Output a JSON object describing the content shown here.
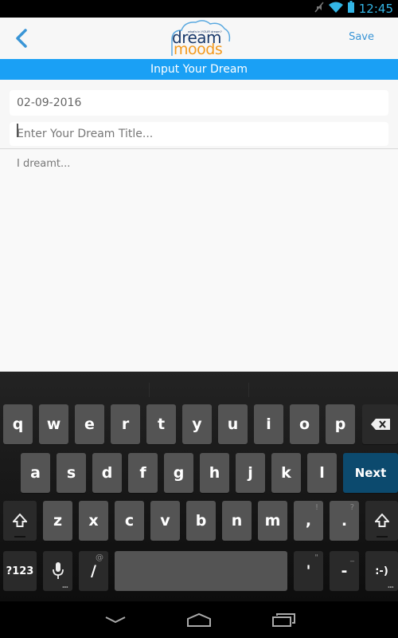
{
  "status_bar": {
    "time": "12:45",
    "icons": [
      "mute-icon",
      "wifi-icon",
      "battery-icon"
    ],
    "accent_color": "#33b5e5"
  },
  "app_bar": {
    "back_icon": "chevron-left-icon",
    "logo": {
      "tagline": "what's in YOUR dream?",
      "word1": "dream",
      "word2": "moods"
    },
    "save_label": "Save"
  },
  "section_header": {
    "title": "Input Your Dream",
    "color": "#1aa0f5"
  },
  "form": {
    "date_value": "02-09-2016",
    "title_placeholder": "Enter Your Dream Title...",
    "title_value": "",
    "body_placeholder": "I dreamt...",
    "body_value": ""
  },
  "keyboard": {
    "row1": [
      "q",
      "w",
      "e",
      "r",
      "t",
      "y",
      "u",
      "i",
      "o",
      "p"
    ],
    "row2": [
      "a",
      "s",
      "d",
      "f",
      "g",
      "h",
      "j",
      "k",
      "l"
    ],
    "row3": [
      "z",
      "x",
      "c",
      "v",
      "b",
      "n",
      "m"
    ],
    "comma": {
      "label": ",",
      "hint": "!"
    },
    "period": {
      "label": ".",
      "hint": "?"
    },
    "next_label": "Next",
    "symbols_label": "?123",
    "slash": {
      "label": "/",
      "hint": "@"
    },
    "apostrophe": {
      "label": "'",
      "hint": "\""
    },
    "dash": {
      "label": "-",
      "hint": "_"
    },
    "smiley_label": ":-)",
    "more_dots": "...",
    "next_color": "#0c4a6e",
    "backspace_icon": "backspace-icon",
    "shift_icon": "shift-icon",
    "mic_icon": "microphone-icon"
  },
  "nav_bar": {
    "buttons": [
      "back-down-icon",
      "home-icon",
      "recents-icon"
    ]
  }
}
